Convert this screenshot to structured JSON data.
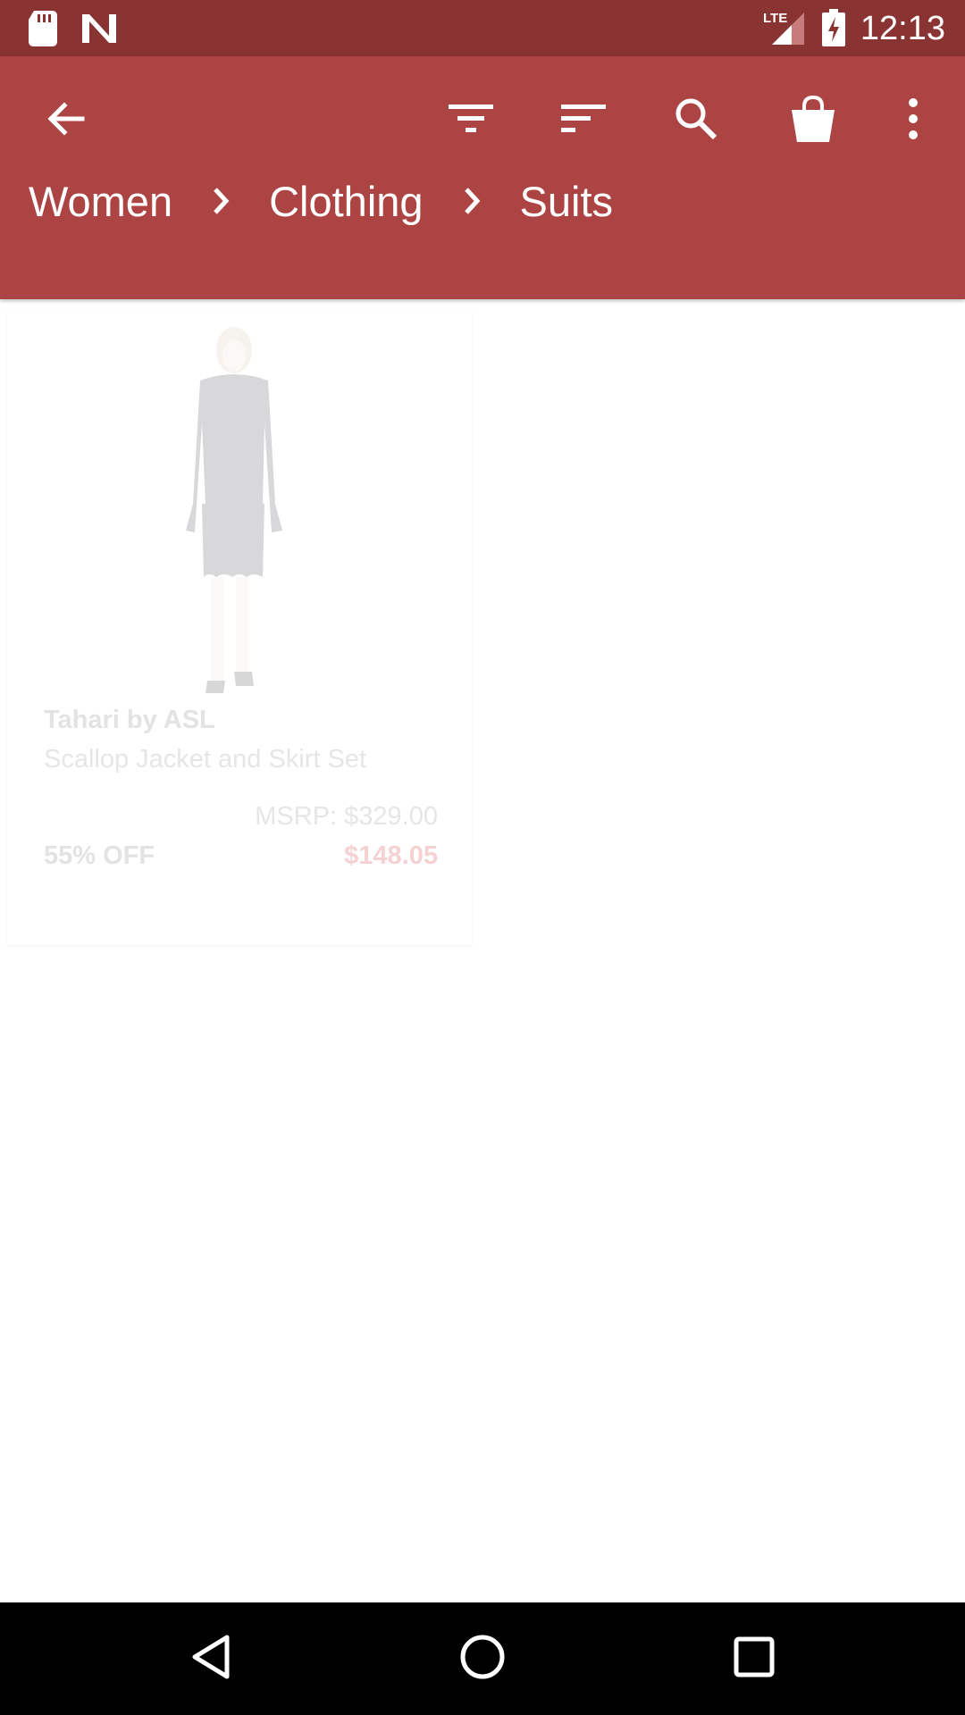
{
  "status_bar": {
    "time": "12:13",
    "network_label": "LTE",
    "icons": [
      "sd-card-icon",
      "n-notification-icon",
      "lte-signal-icon",
      "battery-charging-icon"
    ]
  },
  "app_bar": {
    "colors": {
      "status_bar": "#8a3333",
      "toolbar": "#ad4444"
    },
    "actions": [
      "back-arrow-icon",
      "filter-icon",
      "sort-icon",
      "search-icon",
      "shopping-bag-icon",
      "more-vert-icon"
    ]
  },
  "breadcrumb": {
    "items": [
      "Women",
      "Clothing",
      "Suits"
    ]
  },
  "products": [
    {
      "brand": "Tahari by ASL",
      "name": "Scallop Jacket and Skirt Set",
      "msrp": "MSRP: $329.00",
      "discount": "55% OFF",
      "price": "$148.05",
      "image": "woman-in-dark-skirt-suit"
    }
  ],
  "nav_bar": {
    "icons": [
      "back-triangle-icon",
      "home-circle-icon",
      "recents-square-icon"
    ]
  }
}
